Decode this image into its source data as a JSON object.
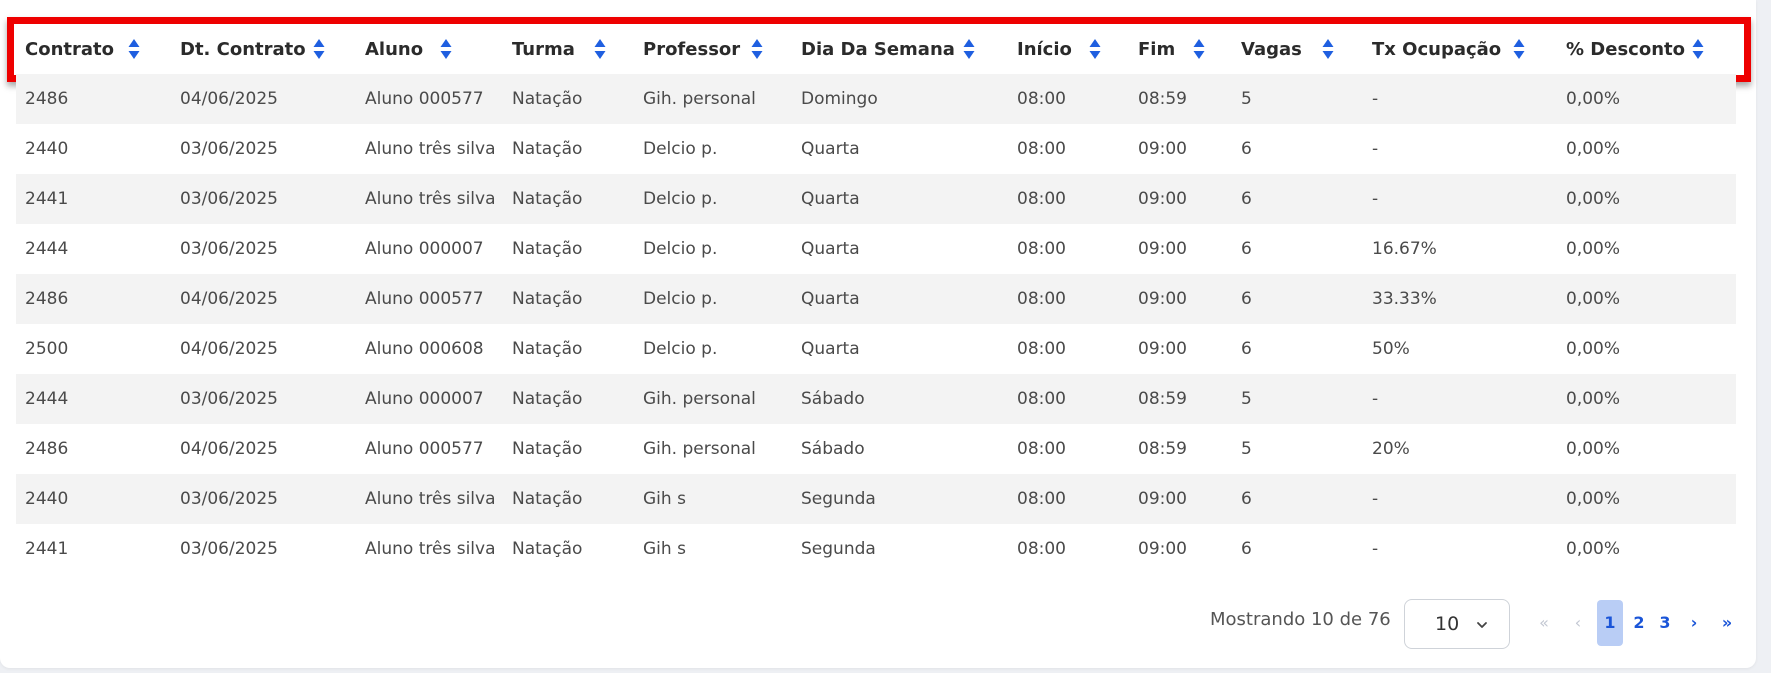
{
  "table": {
    "columns": [
      {
        "label": "Contrato"
      },
      {
        "label": "Dt. Contrato"
      },
      {
        "label": "Aluno"
      },
      {
        "label": "Turma"
      },
      {
        "label": "Professor"
      },
      {
        "label": "Dia Da Semana"
      },
      {
        "label": "Início"
      },
      {
        "label": "Fim"
      },
      {
        "label": "Vagas"
      },
      {
        "label": "Tx Ocupação"
      },
      {
        "label": "% Desconto"
      }
    ],
    "rows": [
      [
        "2486",
        "04/06/2025",
        "Aluno 000577",
        "Natação",
        "Gih. personal",
        "Domingo",
        "08:00",
        "08:59",
        "5",
        "-",
        "0,00%"
      ],
      [
        "2440",
        "03/06/2025",
        "Aluno três silva",
        "Natação",
        "Delcio p.",
        "Quarta",
        "08:00",
        "09:00",
        "6",
        "-",
        "0,00%"
      ],
      [
        "2441",
        "03/06/2025",
        "Aluno três silva",
        "Natação",
        "Delcio p.",
        "Quarta",
        "08:00",
        "09:00",
        "6",
        "-",
        "0,00%"
      ],
      [
        "2444",
        "03/06/2025",
        "Aluno 000007",
        "Natação",
        "Delcio p.",
        "Quarta",
        "08:00",
        "09:00",
        "6",
        "16.67%",
        "0,00%"
      ],
      [
        "2486",
        "04/06/2025",
        "Aluno 000577",
        "Natação",
        "Delcio p.",
        "Quarta",
        "08:00",
        "09:00",
        "6",
        "33.33%",
        "0,00%"
      ],
      [
        "2500",
        "04/06/2025",
        "Aluno 000608",
        "Natação",
        "Delcio p.",
        "Quarta",
        "08:00",
        "09:00",
        "6",
        "50%",
        "0,00%"
      ],
      [
        "2444",
        "03/06/2025",
        "Aluno 000007",
        "Natação",
        "Gih. personal",
        "Sábado",
        "08:00",
        "08:59",
        "5",
        "-",
        "0,00%"
      ],
      [
        "2486",
        "04/06/2025",
        "Aluno 000577",
        "Natação",
        "Gih. personal",
        "Sábado",
        "08:00",
        "08:59",
        "5",
        "20%",
        "0,00%"
      ],
      [
        "2440",
        "03/06/2025",
        "Aluno três silva",
        "Natação",
        "Gih s",
        "Segunda",
        "08:00",
        "09:00",
        "6",
        "-",
        "0,00%"
      ],
      [
        "2441",
        "03/06/2025",
        "Aluno três silva",
        "Natação",
        "Gih s",
        "Segunda",
        "08:00",
        "09:00",
        "6",
        "-",
        "0,00%"
      ]
    ]
  },
  "footer": {
    "showing_text": "Mostrando 10 de 76",
    "page_size": "10",
    "pagination": {
      "first": "«",
      "prev": "‹",
      "pages": [
        "1",
        "2",
        "3"
      ],
      "current_page": "1",
      "next": "›",
      "last": "»"
    }
  },
  "colors": {
    "highlight_border": "#ee0000",
    "sort_icon": "#1f5fe0",
    "link": "#1a55d8",
    "active_page_bg": "#b9cdf5"
  },
  "icons": {
    "sort": "sort-icon",
    "page_size_toggle": "chevron-down-icon"
  }
}
